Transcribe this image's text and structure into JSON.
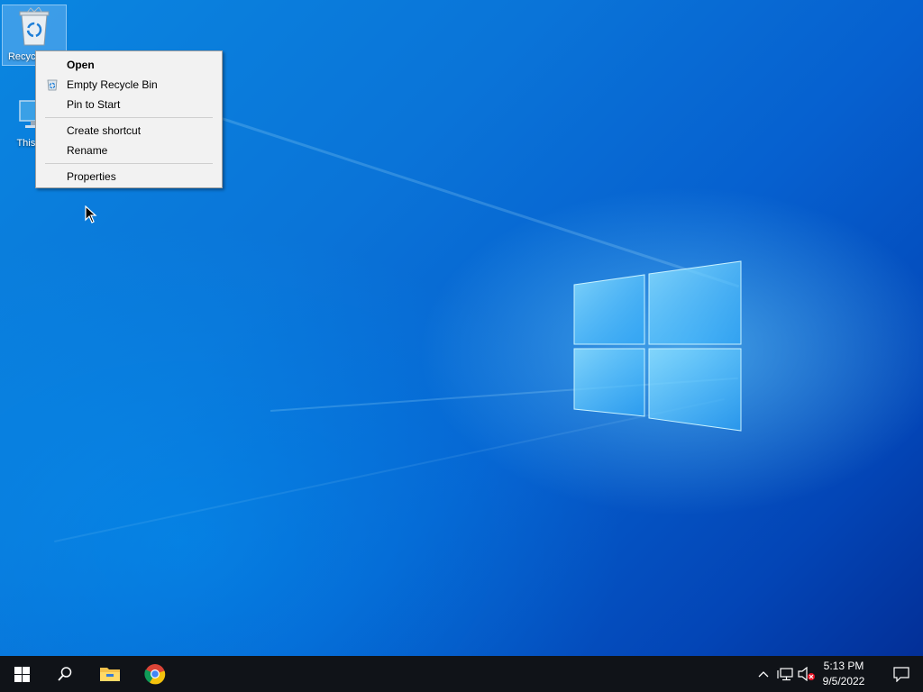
{
  "desktop": {
    "icons": [
      {
        "label": "Recycle Bin"
      },
      {
        "label": "This PC"
      }
    ]
  },
  "context_menu": {
    "items": [
      {
        "label": "Open",
        "bold": true
      },
      {
        "label": "Empty Recycle Bin",
        "icon": "recycle-icon"
      },
      {
        "label": "Pin to Start"
      },
      {
        "label": "Create shortcut"
      },
      {
        "label": "Rename"
      },
      {
        "label": "Properties"
      }
    ]
  },
  "taskbar": {
    "pinned": [
      "start-icon",
      "search-icon",
      "file-explorer-icon",
      "chrome-icon"
    ],
    "tray_icons": [
      "chevron-up-icon",
      "network-icon",
      "volume-muted-icon"
    ],
    "clock": {
      "time": "5:13 PM",
      "date": "9/5/2022"
    },
    "notification_icon": "action-center-icon"
  },
  "colors": {
    "desktop_accent": "#0a74d8",
    "taskbar": "#101318",
    "menu_bg": "#f2f2f2"
  }
}
